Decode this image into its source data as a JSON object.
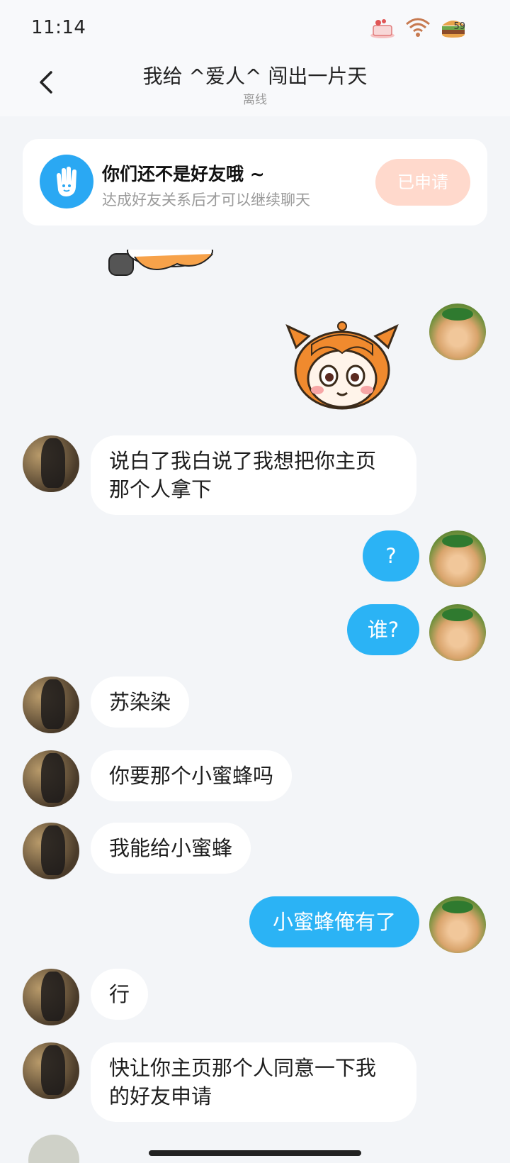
{
  "status_bar": {
    "time": "11:14",
    "battery_level": "59"
  },
  "header": {
    "title": "我给 ^爱人^ 闯出一片天",
    "status": "离线"
  },
  "notice": {
    "title": "你们还不是好友哦 ~",
    "description": "达成好友关系后才可以继续聊天",
    "button_label": "已申请"
  },
  "messages": [
    {
      "side": "them",
      "text": "说白了我白说了我想把你主页\n那个人拿下"
    },
    {
      "side": "me",
      "text": "?"
    },
    {
      "side": "me",
      "text": "谁?"
    },
    {
      "side": "them",
      "text": "苏染染"
    },
    {
      "side": "them",
      "text": "你要那个小蜜蜂吗"
    },
    {
      "side": "them",
      "text": "我能给小蜜蜂"
    },
    {
      "side": "me",
      "text": "小蜜蜂俺有了"
    },
    {
      "side": "them",
      "text": "行"
    },
    {
      "side": "them",
      "text": "快让你主页那个人同意一下我\n的好友申请"
    }
  ],
  "colors": {
    "accent": "#2bb3f5",
    "applied_button": "#ffd9cc",
    "notice_icon": "#2aa8f3"
  },
  "icons": {
    "back": "back-arrow-icon",
    "notice": "waving-hand-icon"
  }
}
